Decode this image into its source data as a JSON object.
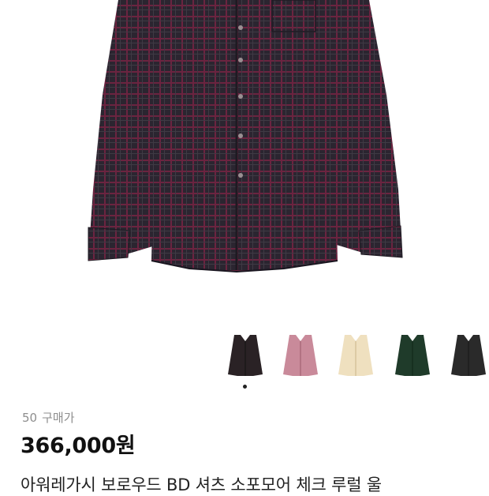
{
  "product": {
    "purchase_count": "50",
    "purchase_label": "구매가",
    "price": "366,000원",
    "title": "아워레가시 보로우드 BD 셔츠 소포모어 체크 루럴 울"
  },
  "colors": {
    "hero_check_base": "#2b2530",
    "hero_check_line": "#6b2440",
    "variant_1": "#2a2225",
    "variant_2": "#c98a9a",
    "variant_3": "#efe0bf",
    "variant_4": "#1f3b2a",
    "variant_5": "#2a2a2a"
  },
  "gallery": {
    "variants": [
      {
        "icon": "shirt-black-check"
      },
      {
        "icon": "shirt-pink-check"
      },
      {
        "icon": "shirt-cream-check"
      },
      {
        "icon": "shirt-green-check"
      },
      {
        "icon": "shirt-charcoal"
      }
    ],
    "active_index": 0
  }
}
